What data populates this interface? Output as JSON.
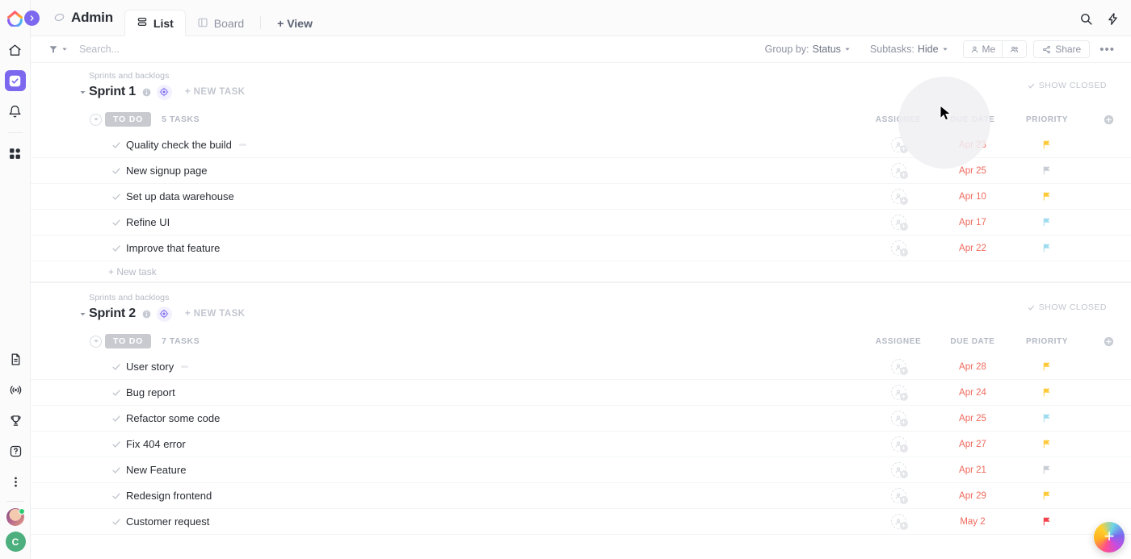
{
  "brand": {
    "logo_name": "clickup-logo",
    "accent": "#7b68ee",
    "due_color": "#f06a5d"
  },
  "sidebar": {
    "top_items": [
      {
        "name": "home",
        "icon": "home-icon",
        "active": false
      },
      {
        "name": "tasks",
        "icon": "check-square-icon",
        "active": true
      },
      {
        "name": "notifications",
        "icon": "bell-icon",
        "active": false
      },
      {
        "name": "dashboards",
        "icon": "grid-icon",
        "active": false
      }
    ],
    "bottom_items": [
      {
        "name": "docs",
        "icon": "document-icon"
      },
      {
        "name": "broadcast",
        "icon": "antenna-icon"
      },
      {
        "name": "goals",
        "icon": "trophy-icon"
      },
      {
        "name": "help",
        "icon": "question-circle-icon"
      },
      {
        "name": "more",
        "icon": "more-vertical-icon"
      }
    ],
    "avatar_initial": "C",
    "status": "online"
  },
  "header": {
    "space_name": "Admin",
    "space_icon": "space-icon",
    "tabs": [
      {
        "label": "List",
        "icon": "list-icon",
        "active": true
      },
      {
        "label": "Board",
        "icon": "board-icon",
        "active": false
      }
    ],
    "add_view_label": "+ View",
    "search_icon": "search-icon",
    "bolt_icon": "lightning-icon"
  },
  "toolbar": {
    "filter_icon": "filter-icon",
    "search_placeholder": "Search...",
    "group_by_label": "Group by:",
    "group_by_value": "Status",
    "subtasks_label": "Subtasks:",
    "subtasks_value": "Hide",
    "me_label": "Me",
    "people_icon": "people-icon",
    "share_label": "Share",
    "more_label": "•••"
  },
  "columns": {
    "assignee": "ASSIGNEE",
    "due_date": "DUE DATE",
    "priority": "PRIORITY",
    "add_column_icon": "plus-circle-icon"
  },
  "groups": [
    {
      "breadcrumb": "Sprints and backlogs",
      "title": "Sprint 1",
      "new_task_label": "+ NEW TASK",
      "show_closed_label": "SHOW CLOSED",
      "status": "TO DO",
      "task_count": "5 TASKS",
      "add_task_label": "+ New task",
      "tasks": [
        {
          "name": "Quality check the build",
          "due": "Apr 23",
          "priority": "#ffca3a",
          "has_dash": true
        },
        {
          "name": "New signup page",
          "due": "Apr 25",
          "priority": "#c8ccd4",
          "has_dash": false
        },
        {
          "name": "Set up data warehouse",
          "due": "Apr 10",
          "priority": "#ffca3a",
          "has_dash": false
        },
        {
          "name": "Refine UI",
          "due": "Apr 17",
          "priority": "#9fdcf0",
          "has_dash": false
        },
        {
          "name": "Improve that feature",
          "due": "Apr 22",
          "priority": "#9fdcf0",
          "has_dash": false
        }
      ]
    },
    {
      "breadcrumb": "Sprints and backlogs",
      "title": "Sprint 2",
      "new_task_label": "+ NEW TASK",
      "show_closed_label": "SHOW CLOSED",
      "status": "TO DO",
      "task_count": "7 TASKS",
      "add_task_label": "+ New task",
      "tasks": [
        {
          "name": "User story",
          "due": "Apr 28",
          "priority": "#ffca3a",
          "has_dash": true
        },
        {
          "name": "Bug report",
          "due": "Apr 24",
          "priority": "#ffca3a",
          "has_dash": false
        },
        {
          "name": "Refactor some code",
          "due": "Apr 25",
          "priority": "#9fdcf0",
          "has_dash": false
        },
        {
          "name": "Fix 404 error",
          "due": "Apr 27",
          "priority": "#ffca3a",
          "has_dash": false
        },
        {
          "name": "New Feature",
          "due": "Apr 21",
          "priority": "#c8ccd4",
          "has_dash": false
        },
        {
          "name": "Redesign frontend",
          "due": "Apr 29",
          "priority": "#ffca3a",
          "has_dash": false
        },
        {
          "name": "Customer request",
          "due": "May 2",
          "priority": "#f5434d",
          "has_dash": false
        }
      ]
    }
  ],
  "fab": {
    "label": "+",
    "name": "create-button"
  }
}
